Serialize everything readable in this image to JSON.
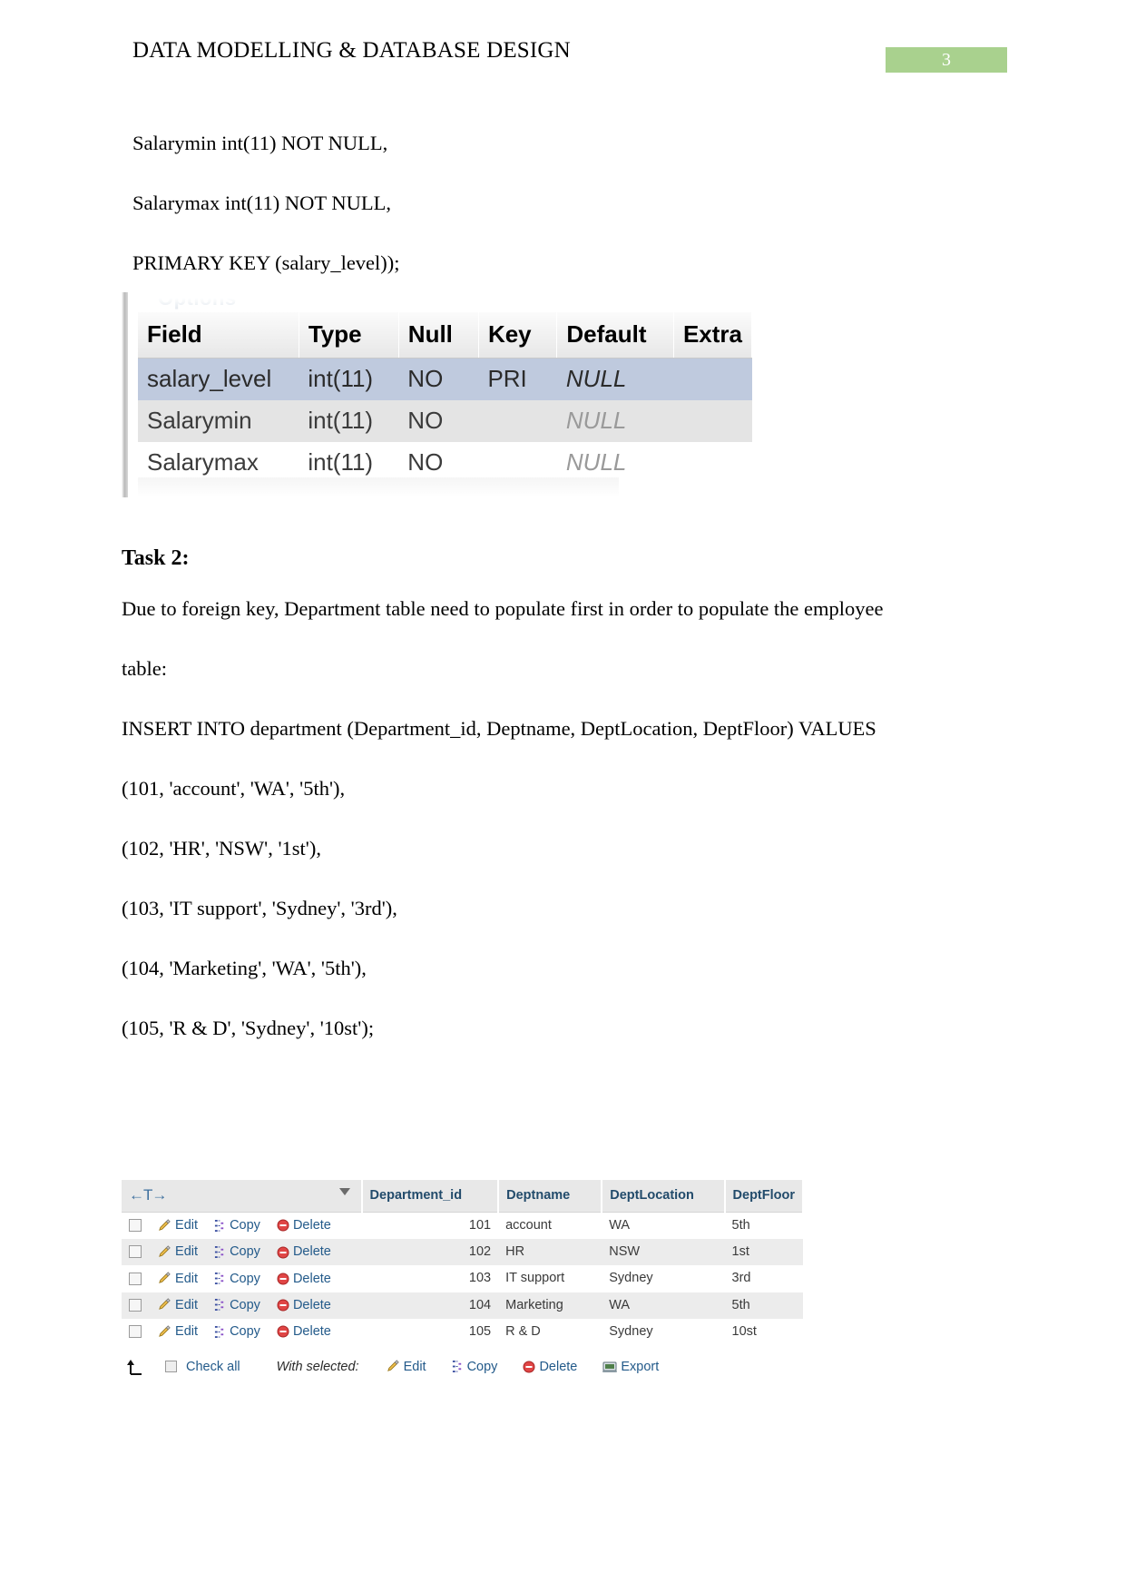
{
  "header": {
    "title": "DATA MODELLING & DATABASE DESIGN",
    "page_number": "3",
    "badge_color": "#a9d18e"
  },
  "sql_lines_top": [
    "Salarymin int(11) NOT NULL,",
    "Salarymax int(11) NOT NULL,",
    "PRIMARY KEY (salary_level));"
  ],
  "structure_screenshot": {
    "options_label": "Options",
    "columns": [
      "Field",
      "Type",
      "Null",
      "Key",
      "Default",
      "Extra"
    ],
    "rows": [
      {
        "field": "salary_level",
        "type": "int(11)",
        "null": "NO",
        "key": "PRI",
        "default": "NULL",
        "extra": ""
      },
      {
        "field": "Salarymin",
        "type": "int(11)",
        "null": "NO",
        "key": "",
        "default": "NULL",
        "extra": ""
      },
      {
        "field": "Salarymax",
        "type": "int(11)",
        "null": "NO",
        "key": "",
        "default": "NULL",
        "extra": ""
      }
    ]
  },
  "task": {
    "heading": "Task 2:",
    "intro_line1": "Due to foreign key, Department table need to populate first in order to populate the employee",
    "intro_line2": "table:",
    "insert_statement": "INSERT INTO department (Department_id, Deptname, DeptLocation, DeptFloor) VALUES",
    "values_lines": [
      "(101, 'account', 'WA', '5th'),",
      "(102, 'HR', 'NSW', '1st'),",
      "(103, 'IT support', 'Sydney', '3rd'),",
      "(104, 'Marketing', 'WA', '5th'),",
      "(105, 'R & D', 'Sydney', '10st');"
    ]
  },
  "result_grid": {
    "nav_label": "←T→",
    "columns": [
      "Department_id",
      "Deptname",
      "DeptLocation",
      "DeptFloor"
    ],
    "action_labels": {
      "edit": "Edit",
      "copy": "Copy",
      "delete": "Delete"
    },
    "rows": [
      {
        "department_id": "101",
        "deptname": "account",
        "deptlocation": "WA",
        "deptfloor": "5th"
      },
      {
        "department_id": "102",
        "deptname": "HR",
        "deptlocation": "NSW",
        "deptfloor": "1st"
      },
      {
        "department_id": "103",
        "deptname": "IT support",
        "deptlocation": "Sydney",
        "deptfloor": "3rd"
      },
      {
        "department_id": "104",
        "deptname": "Marketing",
        "deptlocation": "WA",
        "deptfloor": "5th"
      },
      {
        "department_id": "105",
        "deptname": "R & D",
        "deptlocation": "Sydney",
        "deptfloor": "10st"
      }
    ],
    "footer": {
      "check_all": "Check all",
      "with_selected": "With selected:",
      "edit": "Edit",
      "copy": "Copy",
      "delete": "Delete",
      "export": "Export"
    },
    "link_color": "#235a8a",
    "header_color": "#224b6b"
  }
}
